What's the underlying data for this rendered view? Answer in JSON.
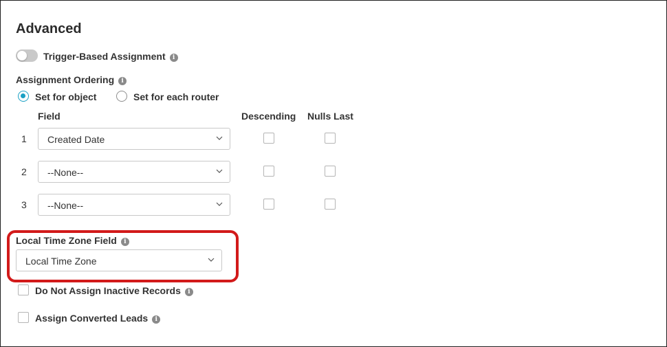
{
  "section": {
    "title": "Advanced"
  },
  "trigger": {
    "label": "Trigger-Based Assignment",
    "enabled": false
  },
  "ordering": {
    "label": "Assignment Ordering",
    "options": [
      {
        "label": "Set for object",
        "selected": true
      },
      {
        "label": "Set for each router",
        "selected": false
      }
    ],
    "columns": {
      "field": "Field",
      "descending": "Descending",
      "nulls_last": "Nulls Last"
    },
    "rows": [
      {
        "num": "1",
        "field": "Created Date",
        "descending": false,
        "nulls_last": false
      },
      {
        "num": "2",
        "field": "--None--",
        "descending": false,
        "nulls_last": false
      },
      {
        "num": "3",
        "field": "--None--",
        "descending": false,
        "nulls_last": false
      }
    ]
  },
  "timezone": {
    "label": "Local Time Zone Field",
    "value": "Local Time Zone"
  },
  "options": {
    "inactive_label": "Do Not Assign Inactive Records",
    "inactive_checked": false,
    "converted_label": "Assign Converted Leads",
    "converted_checked": false
  },
  "colors": {
    "accent": "#1aa0c4",
    "highlight": "#d21a1a"
  }
}
